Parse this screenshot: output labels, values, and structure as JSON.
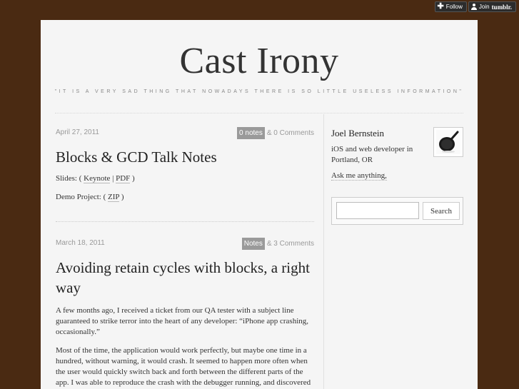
{
  "tumblr_controls": {
    "follow_label": "Follow",
    "join_label": "Join",
    "brand": "tumblr."
  },
  "header": {
    "title": "Cast Irony",
    "tagline": "\"IT IS A VERY SAD THING THAT NOWADAYS THERE IS SO LITTLE USELESS INFORMATION\""
  },
  "posts": [
    {
      "date": "April 27, 2011",
      "notes": "0 notes",
      "comments": "& 0 Comments",
      "title": "Blocks & GCD Talk Notes",
      "slides_label": "Slides: (",
      "keynote": "Keynote",
      "sep": "|",
      "pdf": "PDF",
      "close": ")",
      "demo_label": "Demo Project: (",
      "zip": "ZIP"
    },
    {
      "date": "March 18, 2011",
      "notes": "Notes",
      "comments": "& 3 Comments",
      "title": "Avoiding retain cycles with blocks, a right way",
      "p1": "A few months ago, I received a ticket from our QA tester with a subject line guaranteed to strike terror into the heart of any developer: “iPhone app crashing, occasionally.”",
      "p2": "Most of the time, the application would work perfectly, but maybe one time in a hundred, without warning, it would crash. It seemed to happen more often when the user would quickly switch back and forth between the different parts of the app. I was able to reproduce the crash with the debugger running, and discovered"
    }
  ],
  "sidebar": {
    "author_name": "Joel Bernstein",
    "author_desc": "iOS and web developer in Portland, OR",
    "ask_link": "Ask me anything,",
    "search_placeholder": "",
    "search_button": "Search"
  },
  "colors": {
    "background": "#4a2a12",
    "page": "#f5f5f5",
    "notes_badge": "#9a9a9a"
  },
  "icons": {
    "follow": "plus-icon",
    "join": "user-icon",
    "avatar": "cast-iron-skillet-icon"
  }
}
